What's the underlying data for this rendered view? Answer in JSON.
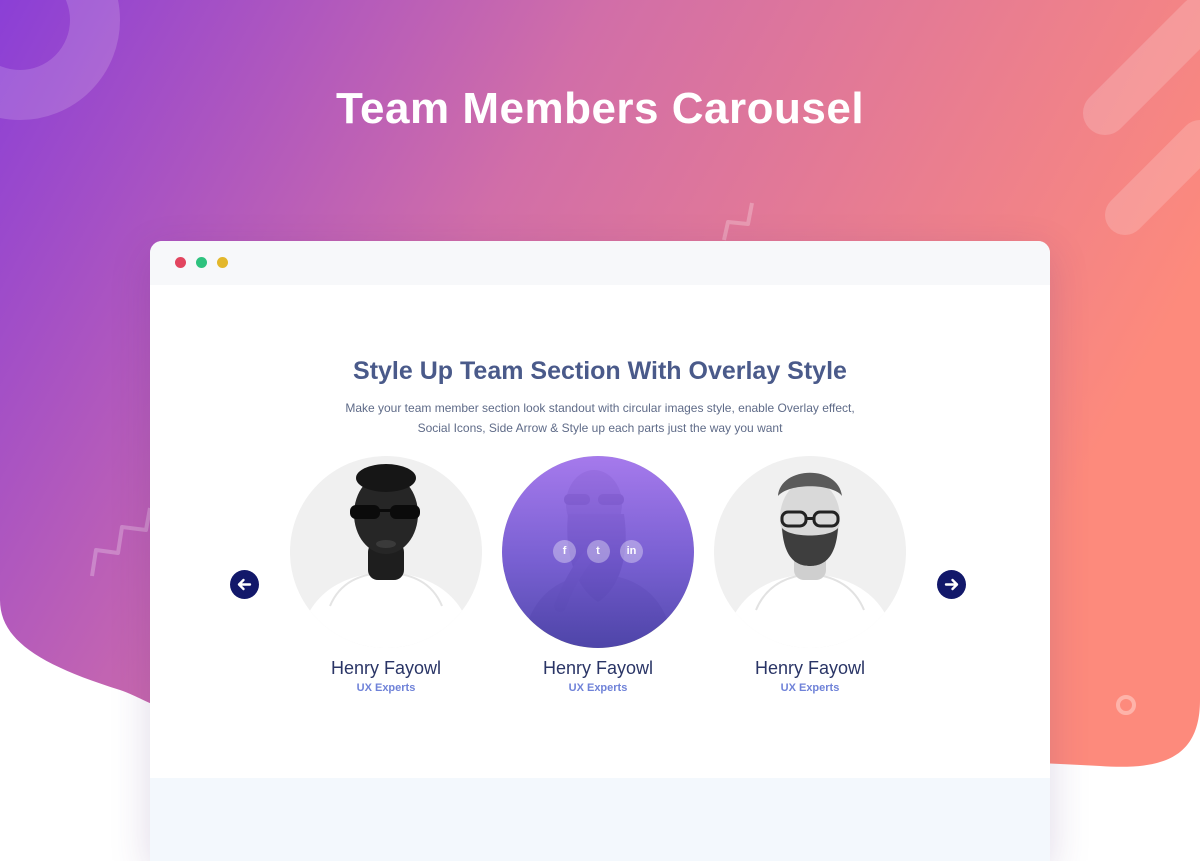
{
  "hero": {
    "title": "Team Members Carousel"
  },
  "browser": {
    "dots": [
      "red",
      "green",
      "yellow"
    ]
  },
  "section": {
    "title": "Style Up Team Section With Overlay Style",
    "description": "Make your team member section look standout with circular images style, enable Overlay effect, Social Icons, Side Arrow & Style up each parts just the way you want"
  },
  "carousel": {
    "prev_icon": "arrow-left-icon",
    "next_icon": "arrow-right-icon",
    "members": [
      {
        "name": "Henry Fayowl",
        "role": "UX Experts",
        "overlay": false
      },
      {
        "name": "Henry Fayowl",
        "role": "UX Experts",
        "overlay": true,
        "socials": [
          "f",
          "t",
          "in"
        ]
      },
      {
        "name": "Henry Fayowl",
        "role": "UX Experts",
        "overlay": false
      }
    ]
  },
  "colors": {
    "gradient_start": "#8b3fd6",
    "gradient_end": "#fb8a7e",
    "title_color": "#4a5a8a",
    "name_color": "#2a3566",
    "role_color": "#6f82d8",
    "arrow_bg": "#12186a"
  }
}
